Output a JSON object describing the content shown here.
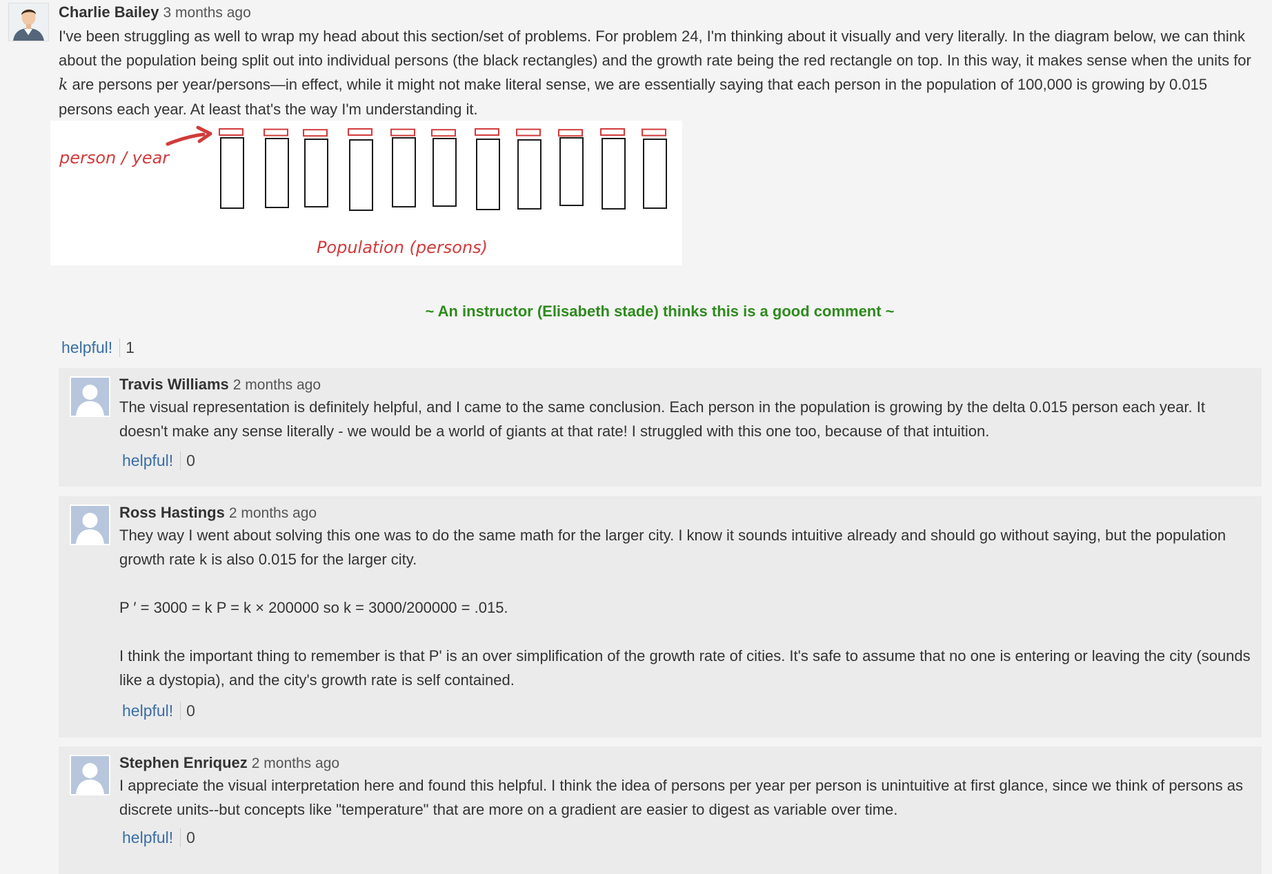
{
  "main_comment": {
    "author": "Charlie Bailey",
    "time": "3 months ago",
    "text_part1": "I've been struggling as well to wrap my head about this section/set of problems. For problem 24, I'm thinking about it visually and very literally. In the diagram below, we can think about the population being split out into individual persons (the black rectangles) and the growth rate being the red rectangle on top. In this way, it makes sense when the units for ",
    "text_var": "k",
    "text_part2": " are persons per year/persons—in effect, while it might not make literal sense, we are essentially saying that each person in the population of 100,000 is growing by 0.015 persons each year. At least that's the way I'm understanding it.",
    "diagram": {
      "left_label": "person / year",
      "bottom_label": "Population (persons)",
      "ink_color": "#d13b3b"
    },
    "endorsement": "~ An instructor (Elisabeth stade) thinks this is a good comment ~",
    "helpful_label": "helpful!",
    "helpful_count": "1"
  },
  "replies": [
    {
      "author": "Travis Williams",
      "time": "2 months ago",
      "paragraphs": [
        "The visual representation is definitely helpful, and I came to the same conclusion.  Each person in the population is growing by the delta 0.015 person each year.  It doesn't make any sense literally - we would be a world of giants at that rate!  I struggled with this one too, because of that intuition."
      ],
      "helpful_label": "helpful!",
      "helpful_count": "0"
    },
    {
      "author": "Ross Hastings",
      "time": "2 months ago",
      "paragraphs": [
        "They way I went about solving this one was to do the same math for the larger city.  I know it sounds intuitive already and should go without saying, but the population growth rate k is also 0.015 for the larger city.",
        "P ′ = 3000 = k P = k × 200000 so k = 3000/200000 = .015.",
        "I think the important thing to remember is that P' is an over simplification of the growth rate of cities.  It's safe to assume that no one is entering or leaving the city (sounds like a dystopia), and the city's growth rate is self contained."
      ],
      "helpful_label": "helpful!",
      "helpful_count": "0"
    },
    {
      "author": "Stephen Enriquez",
      "time": "2 months ago",
      "paragraphs": [
        "I appreciate the visual interpretation here and found this helpful. I think the idea of persons per year per person is unintuitive at first glance, since we think of persons as discrete units--but concepts like \"temperature\" that are more on a gradient are easier to digest as variable over time."
      ],
      "helpful_label": "helpful!",
      "helpful_count": "0"
    }
  ]
}
